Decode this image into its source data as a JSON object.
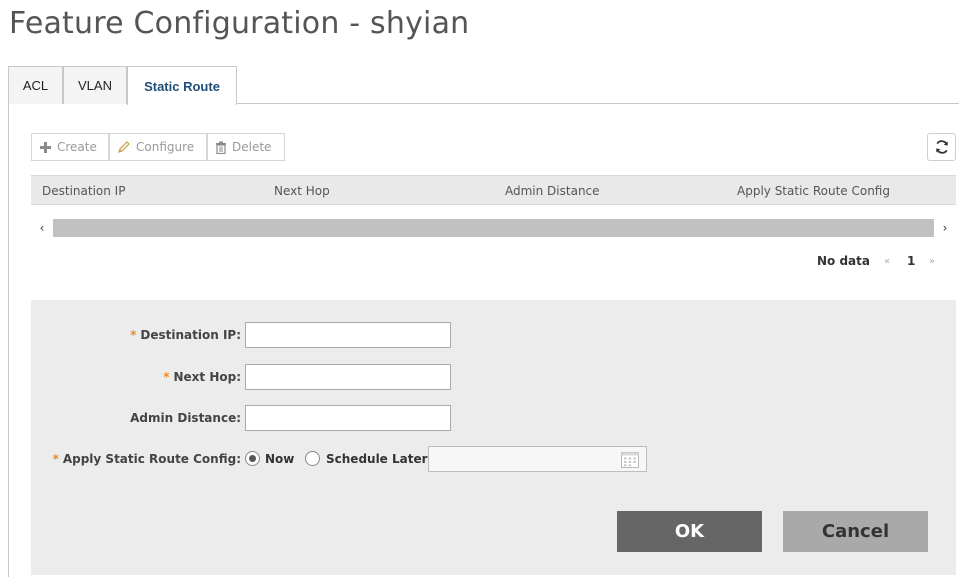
{
  "page": {
    "title": "Feature Configuration - shyian"
  },
  "tabs": [
    {
      "label": "ACL",
      "active": false
    },
    {
      "label": "VLAN",
      "active": false
    },
    {
      "label": "Static Route",
      "active": true
    }
  ],
  "toolbar": {
    "create_label": "Create",
    "configure_label": "Configure",
    "delete_label": "Delete"
  },
  "grid": {
    "columns": [
      "Destination IP",
      "Next Hop",
      "Admin Distance",
      "Apply Static Route Config"
    ],
    "rows": [],
    "scroll_left": "‹",
    "scroll_right": "›"
  },
  "pager": {
    "status": "No data",
    "prev": "«",
    "page": "1",
    "next": "»"
  },
  "form": {
    "destination_ip_label": "Destination IP:",
    "destination_ip_value": "",
    "next_hop_label": "Next Hop:",
    "next_hop_value": "",
    "admin_distance_label": "Admin Distance:",
    "admin_distance_value": "",
    "apply_label": "Apply Static Route Config:",
    "apply_options": [
      {
        "label": "Now",
        "selected": true
      },
      {
        "label": "Schedule Later",
        "selected": false
      }
    ],
    "schedule_value": "",
    "required_marker": "*"
  },
  "actions": {
    "ok_label": "OK",
    "cancel_label": "Cancel"
  },
  "colors": {
    "active_tab_text": "#1f4e79",
    "required": "#f08a24",
    "ok_button": "#666666",
    "cancel_button": "#a9a9a9"
  }
}
